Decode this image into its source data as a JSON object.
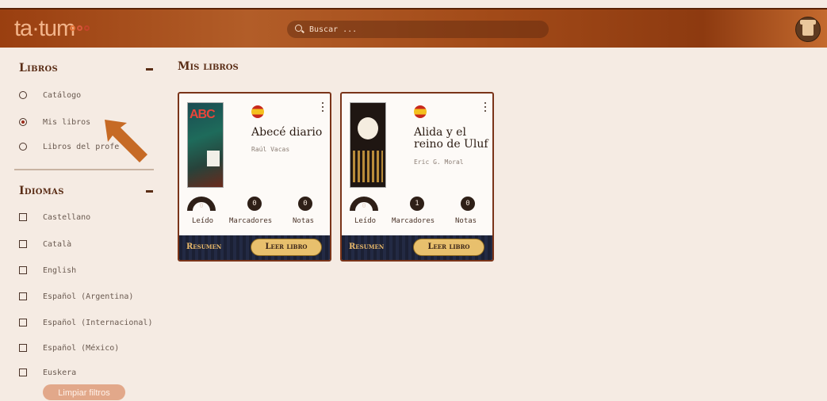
{
  "header": {
    "logo_text": "ta·tum",
    "search_placeholder": "Buscar ..."
  },
  "sidebar": {
    "books_section": {
      "title": "Libros",
      "items": [
        {
          "label": "Catálogo",
          "selected": false
        },
        {
          "label": "Mis libros",
          "selected": true
        },
        {
          "label": "Libros del profe",
          "selected": false
        }
      ]
    },
    "languages_section": {
      "title": "Idiomas",
      "items": [
        {
          "label": "Castellano"
        },
        {
          "label": "Català"
        },
        {
          "label": "English"
        },
        {
          "label": "Español (Argentina)"
        },
        {
          "label": "Español (Internacional)"
        },
        {
          "label": "Español (México)"
        },
        {
          "label": "Euskera"
        }
      ]
    },
    "clear_filters_label": "Limpiar filtros"
  },
  "main": {
    "title": "Mis libros",
    "books": [
      {
        "title": "Abecé diario",
        "author": "Raúl Vacas",
        "read_value": "0",
        "bookmarks": "0",
        "notes": "0",
        "stat_labels": [
          "Leído",
          "Marcadores",
          "Notas"
        ],
        "summary_label": "Resumen",
        "read_button_label": "Leer libro"
      },
      {
        "title": "Alida y el reino de Uluf",
        "author": "Eric G. Moral",
        "read_value": "0",
        "bookmarks": "1",
        "notes": "0",
        "stat_labels": [
          "Leído",
          "Marcadores",
          "Notas"
        ],
        "summary_label": "Resumen",
        "read_button_label": "Leer libro"
      }
    ]
  },
  "colors": {
    "accent": "#9a3f10",
    "arrow": "#c66a25",
    "footer": "#1b2034",
    "button": "#e8c06d"
  }
}
